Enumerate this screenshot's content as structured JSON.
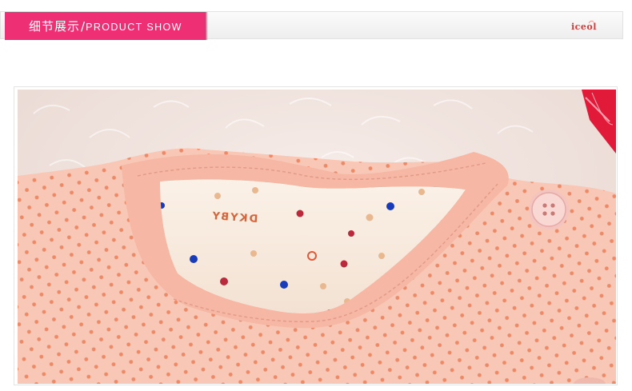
{
  "header": {
    "title_cn": "细节展示",
    "separator": "/",
    "title_en": "PRODUCT SHOW",
    "logo_text": "iceol",
    "accent_color": "#ee2f73"
  },
  "photo": {
    "label_text": "DKYBY",
    "garment_color": "#f7c1b0",
    "fur_color": "#f2e4df"
  }
}
